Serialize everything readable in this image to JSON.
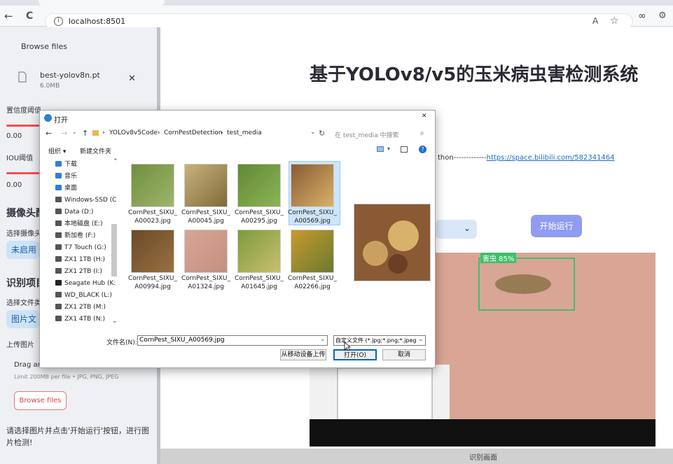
{
  "browser": {
    "tab_title": "基于YOLOv8/v5的玉米病虫害检测系统",
    "url": "localhost:8501",
    "nav": {
      "back": "←",
      "reload": "C",
      "info": "i"
    },
    "read_aloud": "A",
    "favorite": "☆",
    "icons": [
      "back-icon",
      "reload-icon",
      "info-icon",
      "read-aloud-icon",
      "star-icon",
      "copilot-icon",
      "extensions-icon"
    ]
  },
  "sidebar": {
    "browse_top": "Browse files",
    "file_name": "best-yolov8n.pt",
    "file_size": "6.0MB",
    "close": "✕",
    "conf_label": "置信度阈值",
    "conf_value": "0.00",
    "iou_label": "IOU阈值",
    "iou_value": "0.00",
    "camera_header": "摄像头配",
    "camera_select_label": "选择摄像头",
    "camera_select_value": "未启用摄",
    "file_header": "识别项目",
    "file_type_label": "选择文件类",
    "file_type_value": "图片文件",
    "upload_label": "上传图片",
    "drag_text": "Drag and drop file here",
    "limit_text": "Limit 200MB per file • JPG, PNG, JPEG",
    "browse_button": "Browse files",
    "hint": "请选择图片并点击'开始运行'按钮，进行图片检测!"
  },
  "main": {
    "title": "基于YOLOv8/v5的玉米病虫害检测系统",
    "link_prefix": "thon-------------",
    "link": "https://space.bilibili.com/582341464",
    "run_button": "开始运行",
    "select_chevron": "⌄",
    "detection_label": "害虫  85%",
    "bottom_caption": "识别画面"
  },
  "dialog": {
    "title": "打开",
    "close": "✕",
    "breadcrumb": [
      "YOLOv8v5Code",
      "CornPestDetection",
      "test_media"
    ],
    "search_placeholder": "在 test_media 中搜索",
    "organize": "组织 ▾",
    "new_folder": "新建文件夹",
    "nav_items": [
      {
        "label": "下载",
        "color": "#2f7fd6"
      },
      {
        "label": "音乐",
        "color": "#2f7fd6"
      },
      {
        "label": "桌面",
        "color": "#2f7fd6"
      },
      {
        "label": "Windows-SSD (C",
        "color": "#555"
      },
      {
        "label": "Data (D:)",
        "color": "#555"
      },
      {
        "label": "本地磁盘 (E:)",
        "color": "#555"
      },
      {
        "label": "新加卷 (F:)",
        "color": "#555"
      },
      {
        "label": "T7 Touch (G:)",
        "color": "#555"
      },
      {
        "label": "ZX1 1TB (H:)",
        "color": "#555"
      },
      {
        "label": "ZX1 2TB (I:)",
        "color": "#555"
      },
      {
        "label": "Seagate Hub (K:",
        "color": "#222"
      },
      {
        "label": "WD_BLACK (L:)",
        "color": "#555"
      },
      {
        "label": "ZX1 2TB (M:)",
        "color": "#555"
      },
      {
        "label": "ZX1 4TB (N:)",
        "color": "#555"
      }
    ],
    "files": [
      {
        "name1": "CornPest_SIXU_",
        "name2": "A00023.jpg",
        "c1": "#6f8f3f",
        "c2": "#9fb56a"
      },
      {
        "name1": "CornPest_SIXU_",
        "name2": "A00045.jpg",
        "c1": "#c9b27a",
        "c2": "#7f6a3c"
      },
      {
        "name1": "CornPest_SIXU_",
        "name2": "A00295.jpg",
        "c1": "#5f8a34",
        "c2": "#8db356"
      },
      {
        "name1": "CornPest_SIXU_",
        "name2": "A00569.jpg",
        "c1": "#8a5a34",
        "c2": "#d8b26a"
      },
      {
        "name1": "CornPest_SIXU_",
        "name2": "A00994.jpg",
        "c1": "#6a4a2a",
        "c2": "#9a7040"
      },
      {
        "name1": "CornPest_SIXU_",
        "name2": "A01324.jpg",
        "c1": "#d7a597",
        "c2": "#c49080"
      },
      {
        "name1": "CornPest_SIXU_",
        "name2": "A01645.jpg",
        "c1": "#7d9a3c",
        "c2": "#c8c070"
      },
      {
        "name1": "CornPest_SIXU_",
        "name2": "A02266.jpg",
        "c1": "#c89a2e",
        "c2": "#6a7a30"
      }
    ],
    "filename_label": "文件名(N):",
    "filename_value": "CornPest_SIXU_A00569.jpg",
    "filetype_value": "自定义文件 (*.jpg;*.png;*.jpeg",
    "mobile_upload": "从移动设备上传",
    "open_button": "打开(O)",
    "cancel_button": "取消"
  }
}
